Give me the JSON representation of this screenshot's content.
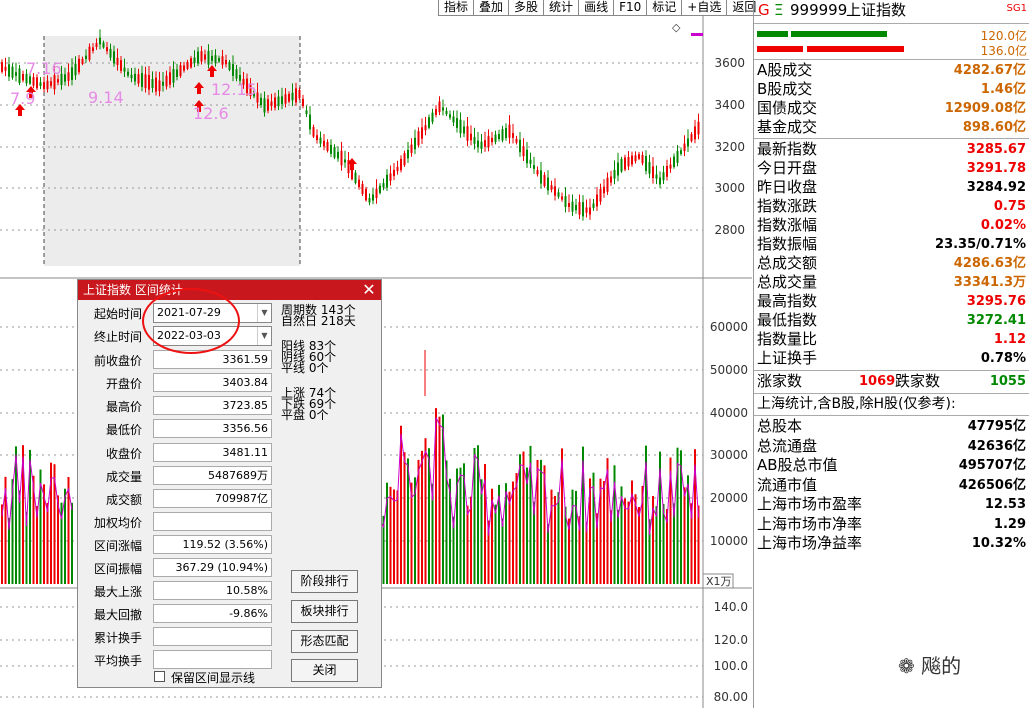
{
  "toolbar": [
    "指标",
    "叠加",
    "多股",
    "统计",
    "画线",
    "F10",
    "标记",
    "+自选",
    "返回"
  ],
  "price_axis": [
    "3600",
    "3400",
    "3200",
    "3000",
    "2800"
  ],
  "volume_axis": [
    "60000",
    "50000",
    "40000",
    "30000",
    "20000",
    "10000"
  ],
  "volume_unit": "X1万",
  "bottom_axis": [
    "140.0",
    "120.0",
    "100.0",
    "80.00"
  ],
  "chart_annotations": [
    "7.16",
    "7.9",
    "9.14",
    "12.15",
    "12.6"
  ],
  "header": {
    "g": "G",
    "eq": "Ξ",
    "code": "999999",
    "name": "上证指数",
    "tag": "SG1"
  },
  "bars": {
    "top_value": "120.0亿",
    "bottom_value": "136.0亿"
  },
  "right_rows": [
    {
      "label": "A股成交",
      "value": "4282.67亿",
      "color": "brown"
    },
    {
      "label": "B股成交",
      "value": "1.46亿",
      "color": "brown"
    },
    {
      "label": "国债成交",
      "value": "12909.08亿",
      "color": "brown"
    },
    {
      "label": "基金成交",
      "value": "898.60亿",
      "color": "brown"
    },
    {
      "label": "最新指数",
      "value": "3285.67",
      "color": "red"
    },
    {
      "label": "今日开盘",
      "value": "3291.78",
      "color": "red"
    },
    {
      "label": "昨日收盘",
      "value": "3284.92",
      "color": "black"
    },
    {
      "label": "指数涨跌",
      "value": "0.75",
      "color": "red"
    },
    {
      "label": "指数涨幅",
      "value": "0.02%",
      "color": "red"
    },
    {
      "label": "指数振幅",
      "value": "23.35/0.71%",
      "color": "black"
    },
    {
      "label": "总成交额",
      "value": "4286.63亿",
      "color": "brown"
    },
    {
      "label": "总成交量",
      "value": "33341.3万",
      "color": "brown"
    },
    {
      "label": "最高指数",
      "value": "3295.76",
      "color": "red"
    },
    {
      "label": "最低指数",
      "value": "3272.41",
      "color": "green"
    },
    {
      "label": "指数量比",
      "value": "1.12",
      "color": "red"
    },
    {
      "label": "上证换手",
      "value": "0.78%",
      "color": "black"
    }
  ],
  "updown": {
    "up_label": "涨家数",
    "up_value": "1069",
    "down_label": "跌家数",
    "down_value": "1055"
  },
  "stats_title": "上海统计,含B股,除H股(仅参考):",
  "stats_rows": [
    {
      "label": "总股本",
      "value": "47795亿"
    },
    {
      "label": "总流通盘",
      "value": "42636亿"
    },
    {
      "label": "AB股总市值",
      "value": "495707亿"
    },
    {
      "label": "流通市值",
      "value": "426506亿"
    },
    {
      "label": "上海市场市盈率",
      "value": "12.53"
    },
    {
      "label": "上海市场市净率",
      "value": "1.29"
    },
    {
      "label": "上海市场净益率",
      "value": "10.32%"
    }
  ],
  "dialog": {
    "title": "上证指数 区间统计",
    "close": "✕",
    "start_label": "起始时间",
    "start_value": "2021-07-29",
    "end_label": "终止时间",
    "end_value": "2022-03-03",
    "fields": [
      {
        "label": "前收盘价",
        "value": "3361.59"
      },
      {
        "label": "开盘价",
        "value": "3403.84"
      },
      {
        "label": "最高价",
        "value": "3723.85"
      },
      {
        "label": "最低价",
        "value": "3356.56"
      },
      {
        "label": "收盘价",
        "value": "3481.11"
      },
      {
        "label": "成交量",
        "value": "5487689万"
      },
      {
        "label": "成交额",
        "value": "709987亿"
      },
      {
        "label": "加权均价",
        "value": ""
      },
      {
        "label": "区间涨幅",
        "value": "119.52 (3.56%)"
      },
      {
        "label": "区间振幅",
        "value": "367.29 (10.94%)"
      },
      {
        "label": "最大上涨",
        "value": "10.58%"
      },
      {
        "label": "最大回撤",
        "value": "-9.86%"
      },
      {
        "label": "累计换手",
        "value": ""
      },
      {
        "label": "平均换手",
        "value": ""
      }
    ],
    "period_label": "周期数",
    "period_value": "143个",
    "natural_label": "自然日",
    "natural_value": "218天",
    "yang_label": "阳线",
    "yang_value": "83个",
    "yin_label": "阴线",
    "yin_value": "60个",
    "flat_label": "平线",
    "flat_value": "0个",
    "up_label": "上涨",
    "up_value": "74个",
    "down_label": "下跌",
    "down_value": "69个",
    "even_label": "平盘",
    "even_value": "0个",
    "buttons": [
      "阶段排行",
      "板块排行",
      "形态匹配",
      "关闭"
    ],
    "checkbox_label": "保留区间显示线"
  },
  "watermark": "飚的"
}
